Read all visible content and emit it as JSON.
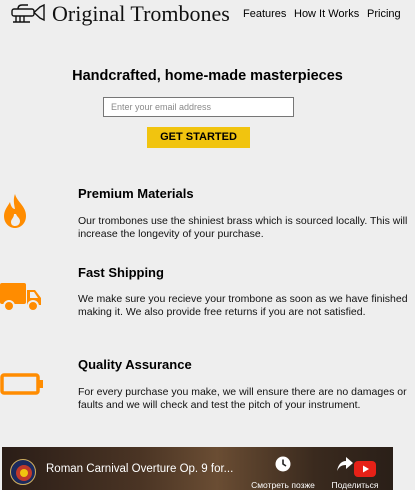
{
  "header": {
    "brand": "Original Trombones",
    "nav": [
      "Features",
      "How It Works",
      "Pricing"
    ]
  },
  "hero": {
    "title": "Handcrafted, home-made masterpieces",
    "email_placeholder": "Enter your email address",
    "cta_label": "GET STARTED"
  },
  "features": [
    {
      "icon": "flame-icon",
      "title": "Premium Materials",
      "description": "Our trombones use the shiniest brass which is sourced locally. This will increase the longevity of your purchase."
    },
    {
      "icon": "truck-icon",
      "title": "Fast Shipping",
      "description": "We make sure you recieve your trombone as soon as we have finished making it. We also provide free returns if you are not satisfied."
    },
    {
      "icon": "battery-icon",
      "title": "Quality Assurance",
      "description": "For every purchase you make, we will ensure there are no damages or faults and we will check and test the pitch of your instrument."
    }
  ],
  "video": {
    "title": "Roman Carnival Overture Op. 9 for...",
    "watch_later_label": "Смотреть позже",
    "share_label": "Поделиться"
  },
  "colors": {
    "accent": "#f1c40f",
    "icon": "#ff8c00",
    "background": "#eeeeee"
  }
}
